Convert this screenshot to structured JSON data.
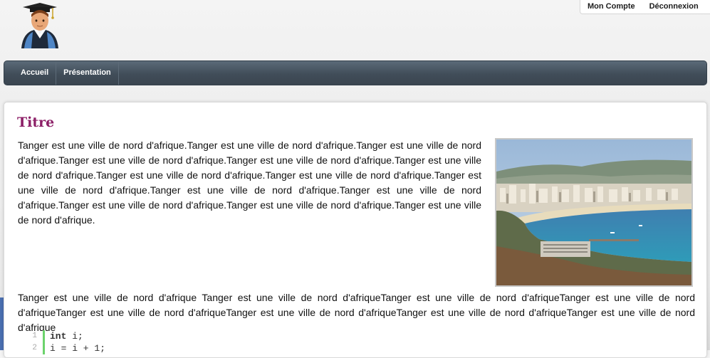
{
  "header": {
    "account_links": [
      "Mon Compte",
      "Déconnexion"
    ],
    "avatar_icon": "graduate-avatar-icon"
  },
  "nav": {
    "items": [
      "Accueil",
      "Présentation"
    ]
  },
  "content": {
    "title": "Titre",
    "paragraph1": "Tanger est une ville de nord d'afrique.Tanger est une ville de nord d'afrique.Tanger est une ville de nord d'afrique.Tanger est une ville de nord d'afrique.Tanger est une ville de nord d'afrique.Tanger est une ville de nord d'afrique.Tanger est une ville de nord d'afrique.Tanger est une ville de nord d'afrique.Tanger est une ville de nord d'afrique.Tanger est une ville de nord d'afrique.Tanger est une ville de nord d'afrique.Tanger est une ville de nord d'afrique.Tanger est une ville de nord d'afrique.Tanger est une ville de nord d'afrique.",
    "paragraph2": "Tanger est une ville de nord d'afrique Tanger est une ville de nord d'afriqueTanger est une ville de nord d'afriqueTanger est une ville de nord d'afriqueTanger est une ville de nord d'afriqueTanger est une ville de nord d'afriqueTanger est une ville de nord d'afriqueTanger est une ville de nord d'afrique",
    "image_description": "tanger-bay-photo",
    "code": {
      "lines": [
        {
          "num": "1",
          "keyword": "int",
          "rest": " i;"
        },
        {
          "num": "2",
          "keyword": "",
          "rest": "i = i + 1;"
        }
      ]
    }
  },
  "colors": {
    "title": "#8c1f67",
    "nav_bg": "#414d59",
    "code_bar": "#6cd36c"
  }
}
